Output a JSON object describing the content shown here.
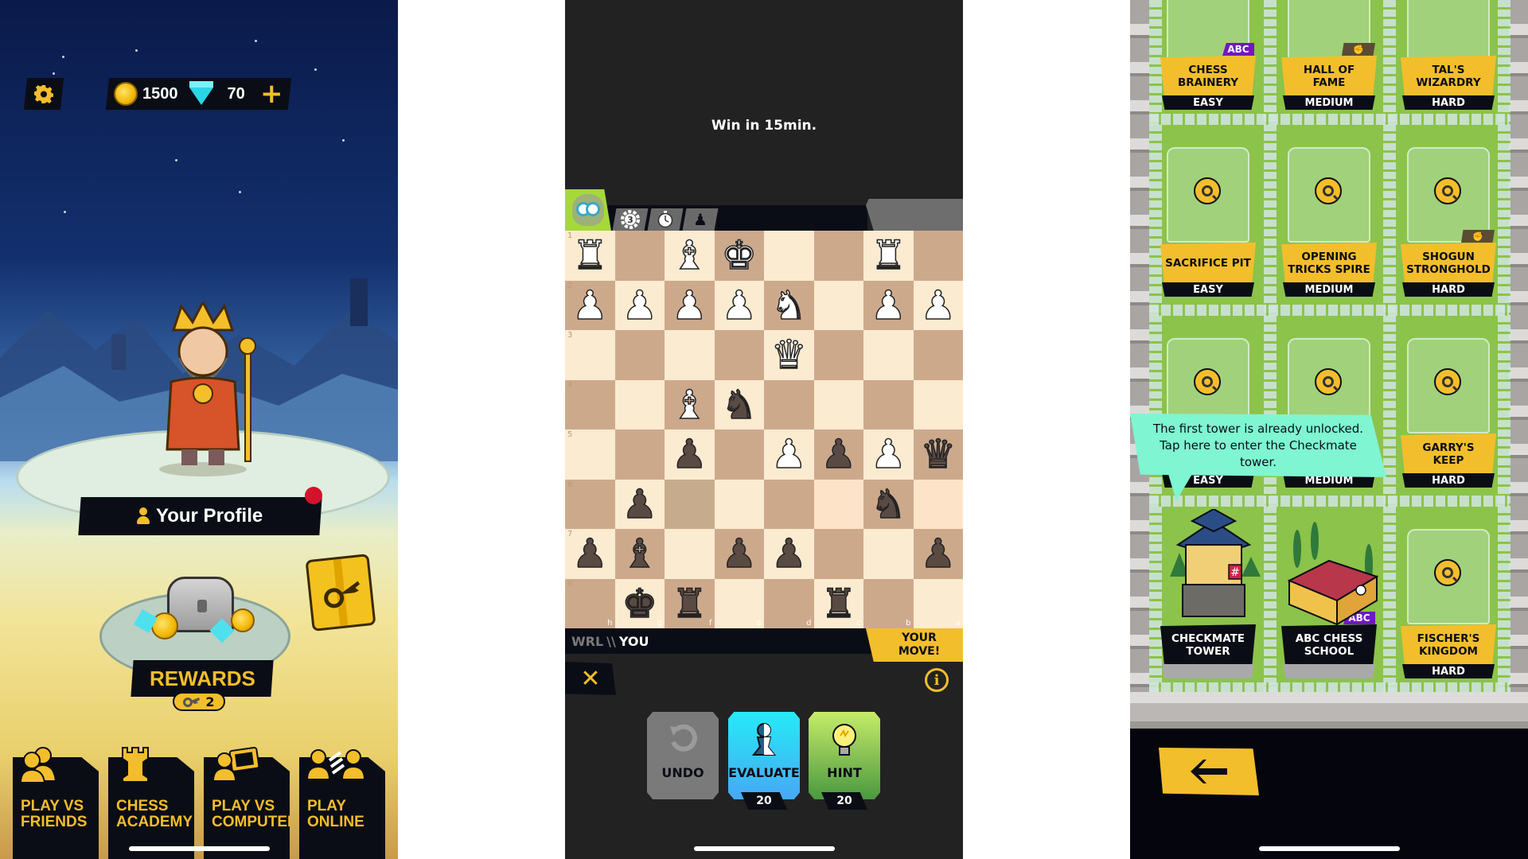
{
  "home": {
    "settings_icon": "gear-icon",
    "coins": "1500",
    "gems": "70",
    "add_currency_icon": "plus-icon",
    "profile_label": "Your Profile",
    "profile_notification": true,
    "rewards_label": "REWARDS",
    "rewards_keys": "2",
    "nav": [
      {
        "label_line1": "PLAY VS",
        "label_line2": "FRIENDS",
        "icon": "friends-icon"
      },
      {
        "label_line1": "CHESS",
        "label_line2": "ACADEMY",
        "icon": "rook-icon"
      },
      {
        "label_line1": "PLAY VS",
        "label_line2": "COMPUTER",
        "icon": "computer-icon"
      },
      {
        "label_line1": "PLAY",
        "label_line2": "ONLINE",
        "icon": "online-icon"
      }
    ]
  },
  "game": {
    "objective": "Win in 15min.",
    "tabs": [
      {
        "icon": "gear-level-icon",
        "value": "3"
      },
      {
        "icon": "stopwatch-icon",
        "value": ""
      },
      {
        "icon": "pawn-icon",
        "value": ""
      }
    ],
    "opponent": "WRL",
    "separator": "\\\\",
    "player": "YOU",
    "turn_line1": "YOUR",
    "turn_line2": "MOVE!",
    "ranks": [
      "1",
      "2",
      "3",
      "4",
      "5",
      "6",
      "7",
      "8"
    ],
    "files": [
      "h",
      "g",
      "f",
      "e",
      "d",
      "c",
      "b",
      "a"
    ],
    "board": [
      [
        "wR",
        "",
        "wB",
        "wK",
        "",
        "",
        "wR",
        ""
      ],
      [
        "wP",
        "wP",
        "wP",
        "wP",
        "wN",
        "",
        "wP",
        "wP"
      ],
      [
        "",
        "",
        "",
        "",
        "wQ",
        "",
        "",
        ""
      ],
      [
        "",
        "",
        "wB",
        "bN",
        "",
        "",
        "",
        ""
      ],
      [
        "",
        "",
        "bP",
        "",
        "wP",
        "bP",
        "wP",
        "bQ"
      ],
      [
        "",
        "bP",
        "",
        "",
        "",
        "",
        "bN",
        ""
      ],
      [
        "bP",
        "bB",
        "",
        "bP",
        "bP",
        "",
        "",
        "bP"
      ],
      [
        "",
        "bK",
        "bR",
        "",
        "",
        "bR",
        "",
        ""
      ]
    ],
    "actions": [
      {
        "label": "UNDO",
        "count": "",
        "color": "#7a7a7a",
        "enabled": false
      },
      {
        "label": "EVALUATE",
        "count": "20",
        "color": "#29d7f3",
        "enabled": true
      },
      {
        "label": "HINT",
        "count": "20",
        "color": "#8fc84a",
        "enabled": true
      }
    ]
  },
  "towers": {
    "rows": [
      [
        {
          "name": "CHESS BRAINERY",
          "difficulty": "EASY",
          "tag": "ABC",
          "locked": true
        },
        {
          "name": "HALL OF FAME",
          "difficulty": "MEDIUM",
          "tag": "fist",
          "locked": true
        },
        {
          "name": "TAL'S WIZARDRY",
          "difficulty": "HARD",
          "tag": "",
          "locked": true
        }
      ],
      [
        {
          "name": "SACRIFICE PIT",
          "difficulty": "EASY",
          "tag": "",
          "locked": true
        },
        {
          "name": "OPENING TRICKS SPIRE",
          "difficulty": "MEDIUM",
          "tag": "",
          "locked": true
        },
        {
          "name": "SHOGUN STRONGHOLD",
          "difficulty": "HARD",
          "tag": "fist",
          "locked": true
        }
      ],
      [
        {
          "name": "",
          "difficulty": "EASY",
          "tag": "",
          "locked": true
        },
        {
          "name": "",
          "difficulty": "MEDIUM",
          "tag": "",
          "locked": true
        },
        {
          "name": "GARRY'S KEEP",
          "difficulty": "HARD",
          "tag": "",
          "locked": true
        }
      ],
      [
        {
          "name": "CHECKMATE TOWER",
          "difficulty": "",
          "tag": "",
          "locked": false
        },
        {
          "name": "ABC CHESS SCHOOL",
          "difficulty": "",
          "tag": "ABC",
          "locked": false
        },
        {
          "name": "FISCHER'S KINGDOM",
          "difficulty": "HARD",
          "tag": "",
          "locked": true
        }
      ]
    ],
    "tooltip": "The first tower is already unlocked. Tap here to enter the Checkmate tower.",
    "back_icon": "arrow-left-icon"
  },
  "colors": {
    "accent": "#f3be2b",
    "dark": "#0b0d16",
    "abc_tag": "#7217c4",
    "tooltip": "#7ff5d2"
  }
}
